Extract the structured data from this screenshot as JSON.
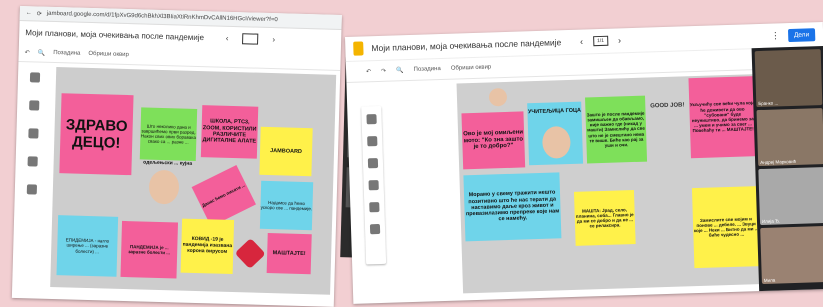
{
  "left_shot": {
    "url": "jamboard.google.com/d/1fpXvG9d6chBkhXl3BIiaXtiRnKhmDvCAllN16HGcI/viewer?f=0",
    "title": "Моји планови, моја очекивања после пандемије",
    "toolbar": {
      "background": "Позадина",
      "clear": "Обриши оквир"
    },
    "notes": {
      "zdravo": "ЗДРАВО ДЕЦО!",
      "green_top": "Што некoлико дана и завршићемо први разред. Након свих ових боравака свако са ... разне ... ",
      "tools": "ШКОЛА, РТС3, ZOOM, КОРИСТИЛИ РАЗЛИЧИТЕ ДИГИТАЛНЕ АЛАТЕ",
      "jamboard": "JAMBOARD",
      "nadam": "Надамсе да ћемо ускоро све ... пандемије.",
      "epidemija": "ЕПИДЕМИЈА - нагло ширење ... (заразне болести) ...",
      "pandemija": "ПАНДЕМИЈА је ... заразне болести ...",
      "kovid": "КОВИД -19 је пандемија изазвана корона вирусом",
      "danas": "Данас ћемо писати ...",
      "mashtaj": "МАШТАЈТЕ!",
      "name_tag": "oдељењски ... кујна"
    }
  },
  "right_shot": {
    "title": "Моји планови, моја очекивања после пандемије",
    "frame": "1/1",
    "share": "Дели",
    "toolbar": {
      "background": "Позадина",
      "clear": "Обриши оквир"
    },
    "notes": {
      "ovo": "Ово је мој омиљени мото: \"Ко зна зашто је то добро?\"",
      "uciteljica": "УЧИТЕЉИЦА ГОЦА",
      "zasto": "Зашто је после пандемије замишљен да обављамо, није важно где (никад у машти) Замислићу да све што не је смештано нема те више. Биће као рај за уши и очи.",
      "ukljucite": "Укључићу све већи чула која ће доживети да ово \"субоване\" буде неуништиво, да бринемо за ... умем и учимо за свет ... Повећаћу ти ... МАШТАЈТЕ!",
      "moramo": "Морамо у свему тражити нешто позитивно што ће нас терати да наставимо даље кроз живот и превазилазимо препреке које нам се намећу.",
      "mashta": "МАШТА: Јрад, село, планина, соба... Главно је да ми се добро и да не ... се релаксира.",
      "zamislite": "Замислите све мојим и понове ... дебеле. ... Звуци које ... Неки ... Битно да ми ... биће чудесно ...",
      "good_job": "GOOD JOB!"
    },
    "meet_names": [
      "Бранко ...",
      "Андреј Марковић",
      "Илија Ђ.",
      "Мила"
    ]
  },
  "colors": {
    "pink": "#f35f9a",
    "green": "#7ee05a",
    "cyan": "#6fd4ea",
    "yellow": "#fff14a",
    "bg": "#f2cfd2"
  }
}
